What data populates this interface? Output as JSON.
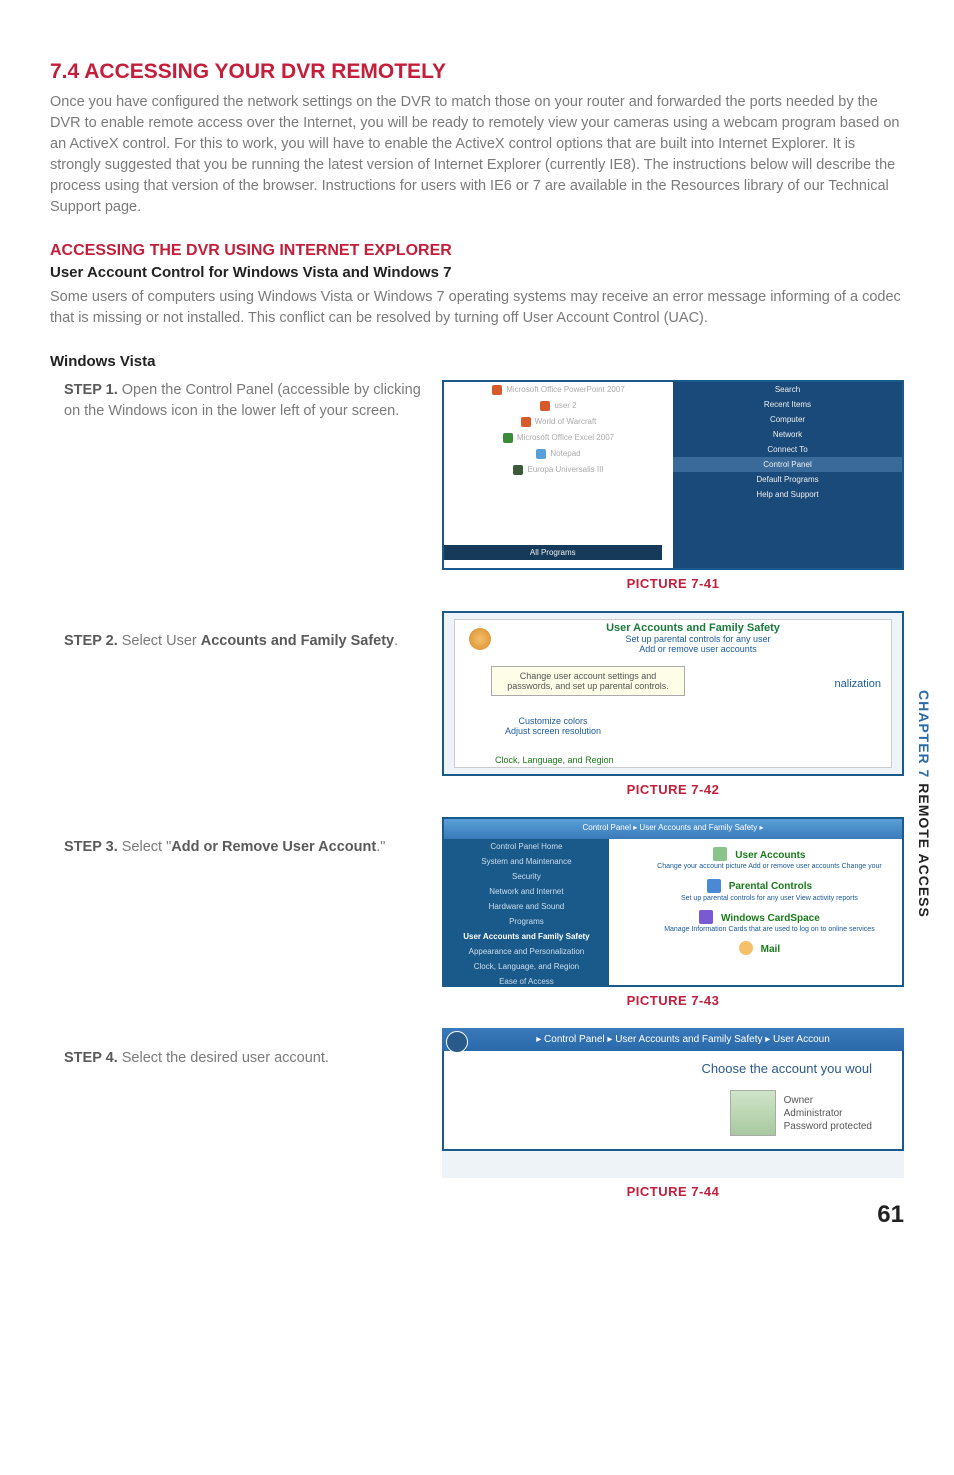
{
  "section": {
    "heading": "7.4 ACCESSING YOUR DVR REMOTELY",
    "body": "Once you have configured the network settings on the DVR to match those on your router and forwarded the ports needed by the DVR to enable remote access over the Internet, you will be ready to remotely view your cameras using a webcam program based on an ActiveX control.  For this to work, you will have to enable the ActiveX control options that are built into Internet Explorer. It is strongly suggested that you be running the latest version of Internet Explorer (currently IE8). The instructions below will describe the process using that version of the browser. Instructions for users with IE6 or 7 are available in the Resources library of our Technical Support page."
  },
  "subsection": {
    "heading": "ACCESSING THE DVR USING INTERNET EXPLORER",
    "subheading": "User Account Control for Windows Vista and Windows 7",
    "body": "Some users of computers using Windows Vista or Windows 7 operating systems may receive an error message informing of a codec that is missing or not installed. This conflict can be resolved by turning off User Account Control (UAC)."
  },
  "os_heading": "Windows Vista",
  "steps": [
    {
      "label": "STEP 1.",
      "text_before": " Open the Control Panel (accessible by clicking on the Windows icon in the lower left of your screen.",
      "bold": "",
      "text_after": "",
      "caption": "PICTURE 7-41"
    },
    {
      "label": "STEP 2.",
      "text_before": " Select User ",
      "bold": "Accounts and Family Safety",
      "text_after": ".",
      "caption": "PICTURE 7-42"
    },
    {
      "label": "STEP 3.",
      "text_before": " Select \"",
      "bold": "Add or Remove User Account",
      "text_after": ".\"",
      "caption": "PICTURE 7-43"
    },
    {
      "label": "STEP 4.",
      "text_before": " Select the desired user account.",
      "bold": "",
      "text_after": "",
      "caption": "PICTURE 7-44"
    }
  ],
  "shot1": {
    "left_items": [
      "Microsoft Office PowerPoint 2007",
      "user 2",
      "World of Warcraft",
      "Microsoft Office Excel 2007",
      "Notepad",
      "Europa Universalis III"
    ],
    "right_items": [
      "Search",
      "Recent Items",
      "Computer",
      "Network",
      "Connect To",
      "Control Panel",
      "Default Programs",
      "Help and Support"
    ],
    "all_programs": "All Programs"
  },
  "shot2": {
    "title": "User Accounts and Family Safety",
    "l1": "Set up parental controls for any user",
    "l2": "Add or remove user accounts",
    "tooltip": "Change user account settings and passwords, and set up parental controls.",
    "pers": "nalization",
    "c1": "Customize colors",
    "c2": "Adjust screen resolution",
    "c3": "Clock, Language, and Region"
  },
  "shot3": {
    "crumb": "Control Panel ▸ User Accounts and Family Safety ▸",
    "left_items": [
      "Control Panel Home",
      "System and Maintenance",
      "Security",
      "Network and Internet",
      "Hardware and Sound",
      "Programs",
      "User Accounts and Family Safety",
      "Appearance and Personalization",
      "Clock, Language, and Region",
      "Ease of Access"
    ],
    "h1": "User Accounts",
    "h1l": "Change your account picture   Add or remove user accounts   Change your",
    "h2": "Parental Controls",
    "h2l": "Set up parental controls for any user   View activity reports",
    "h3": "Windows CardSpace",
    "h3l": "Manage Information Cards that are used to log on to online services",
    "h4": "Mail"
  },
  "shot4": {
    "crumb": "▸ Control Panel ▸ User Accounts and Family Safety ▸ User Accoun",
    "choose": "Choose the account you woul",
    "u1": "Owner",
    "u2": "Administrator",
    "u3": "Password protected"
  },
  "side": {
    "chapter": "CHAPTER 7",
    "title": " REMOTE ACCESS"
  },
  "page_number": "61"
}
